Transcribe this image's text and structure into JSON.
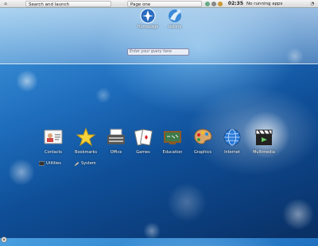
{
  "panel": {
    "kicker_glyph": "⌂",
    "search_tab": "Search and launch",
    "page_tab": "Page one",
    "clock": "02:35",
    "tasks": "No running apps",
    "cashew_glyph": "◔"
  },
  "favorites": [
    {
      "label": "Homepage",
      "icon": "homepage-icon"
    },
    {
      "label": "rekonq",
      "icon": "rekonq-icon"
    }
  ],
  "search": {
    "placeholder": "Enter your query here"
  },
  "categories": [
    {
      "label": "Contacts",
      "icon": "contacts-icon"
    },
    {
      "label": "Bookmarks",
      "icon": "star-icon"
    },
    {
      "label": "Office",
      "icon": "typewriter-icon"
    },
    {
      "label": "Games",
      "icon": "cards-icon"
    },
    {
      "label": "Education",
      "icon": "chalkboard-icon"
    },
    {
      "label": "Graphics",
      "icon": "palette-icon"
    },
    {
      "label": "Internet",
      "icon": "globe-icon"
    },
    {
      "label": "Multimedia",
      "icon": "clapperboard-icon"
    }
  ],
  "secondary": [
    {
      "label": "Utilities",
      "icon": "utilities-icon"
    },
    {
      "label": "System",
      "icon": "system-icon"
    }
  ],
  "colors": {
    "background_top": "#4aa0e0",
    "background_bottom": "#0a2f62",
    "label_text": "#ffffff"
  }
}
